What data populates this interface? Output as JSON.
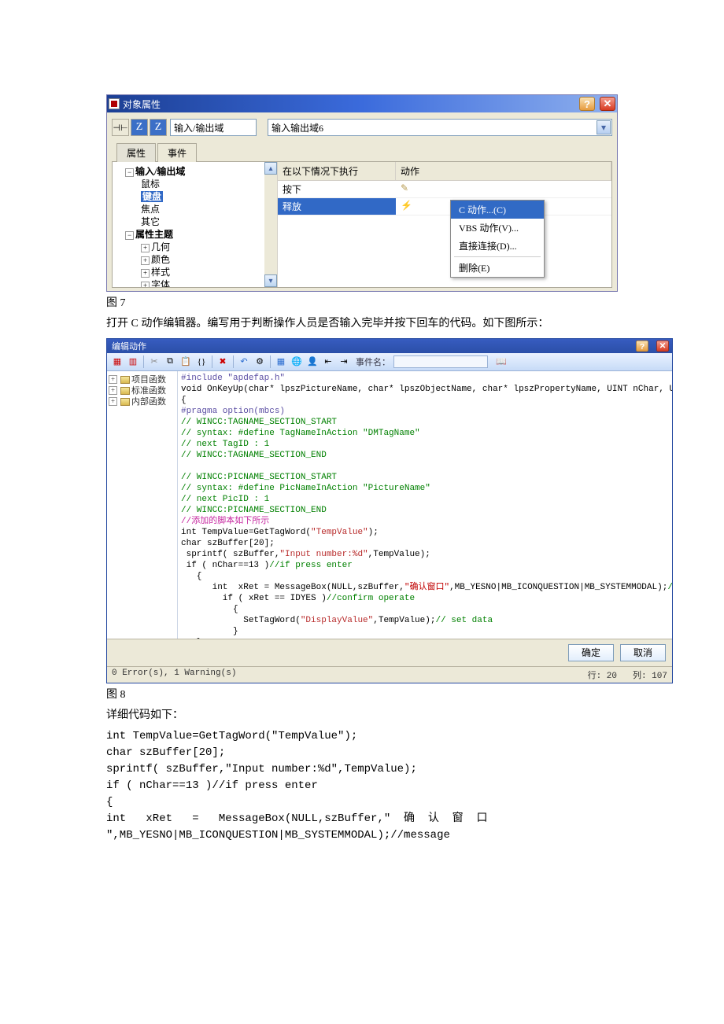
{
  "dlg1": {
    "title": "对象属性",
    "help_btn": "?",
    "close_btn": "✕",
    "combo_type": "输入/输出域",
    "combo_instance": "输入输出域6",
    "tabs": {
      "attr": "属性",
      "event": "事件"
    },
    "tree": {
      "root": "输入/输出域",
      "mouse": "鼠标",
      "keyboard": "键盘",
      "focus": "焦点",
      "other": "其它",
      "theme": "属性主题",
      "geom": "几何",
      "color": "颜色",
      "style": "样式",
      "font": "字体"
    },
    "grid": {
      "h1": "在以下情况下执行",
      "h2": "动作",
      "r1": "按下",
      "r2": "释放"
    },
    "menu": {
      "c_action": "C 动作...(C)",
      "vbs_action": "VBS 动作(V)...",
      "direct": "直接连接(D)...",
      "del": "删除(E)"
    }
  },
  "fig7": "图 7",
  "para1": "打开 C 动作编辑器。编写用于判断操作人员是否输入完毕并按下回车的代码。如下图所示：",
  "dlg2": {
    "title": "编辑动作",
    "event_lbl": "事件名：",
    "tree": {
      "proj": "项目函数",
      "std": "标准函数",
      "intern": "内部函数"
    },
    "code": {
      "l1": "#include \"apdefap.h\"",
      "l2": "void OnKeyUp(char* lpszPictureName, char* lpszObjectName, char* lpszPropertyName, UINT nChar, UINT nRepCnt, UINT nFlags)",
      "l3": "{",
      "l4": "#pragma option(mbcs)",
      "l5": "// WINCC:TAGNAME_SECTION_START",
      "l6": "// syntax: #define TagNameInAction \"DMTagName\"",
      "l7": "// next TagID : 1",
      "l8": "// WINCC:TAGNAME_SECTION_END",
      "l9": "// WINCC:PICNAME_SECTION_START",
      "l10": "// syntax: #define PicNameInAction \"PictureName\"",
      "l11": "// next PicID : 1",
      "l12": "// WINCC:PICNAME_SECTION_END",
      "l13": "//添加的脚本如下所示",
      "l14": "int TempValue=GetTagWord(\"TempValue\");",
      "l15": "char szBuffer[20];",
      "l16": " sprintf( szBuffer,\"Input number:%d\",TempValue);",
      "l17": " if ( nChar==13 )//if press enter",
      "l18": "   {",
      "l19": "      int  xRet = MessageBox(NULL,szBuffer,\"确认窗口\",MB_YESNO|MB_ICONQUESTION|MB_SYSTEMMODAL);//message",
      "l20": "        if ( xRet == IDYES )//confirm operate",
      "l21": "          {",
      "l22": "            SetTagWord(\"DisplayValue\",TempValue);// set data",
      "l23": "          }",
      "l24": "   }",
      "l25": "}"
    },
    "ok": "确定",
    "cancel": "取消",
    "status_err": "0 Error(s), 1 Warning(s)",
    "status_line": "行: 20",
    "status_col": "列: 107"
  },
  "fig8": "图 8",
  "para2": "详细代码如下：",
  "code_text": {
    "l1": "int TempValue=GetTagWord(\"TempValue\");",
    "l2": "char szBuffer[20];",
    "l3": "sprintf( szBuffer,\"Input number:%d\",TempValue);",
    "l4": "if ( nChar==13 )//if press enter",
    "l5": "{",
    "l6": "int   xRet   =   MessageBox(NULL,szBuffer,\"  确  认  窗  口",
    "l7": "\",MB_YESNO|MB_ICONQUESTION|MB_SYSTEMMODAL);//message"
  }
}
